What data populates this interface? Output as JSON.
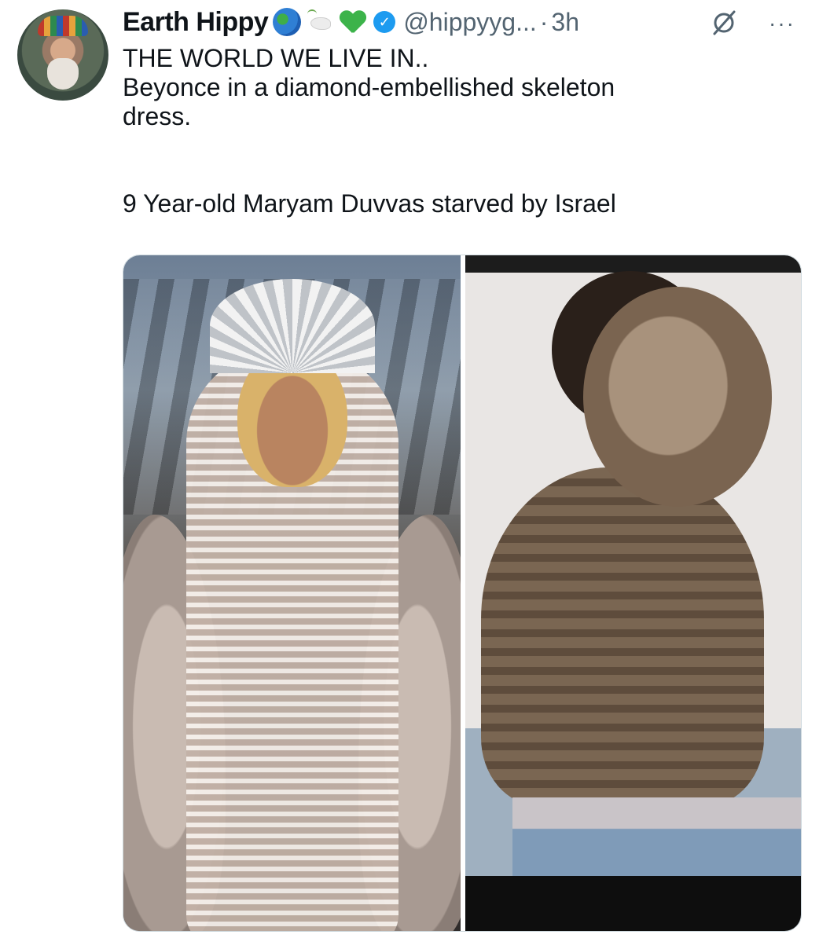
{
  "post": {
    "display_name": "Earth Hippy",
    "name_emojis": [
      "globe-icon",
      "dove-icon",
      "green-heart-icon"
    ],
    "verified_mark": "✓",
    "handle": "@hippyyg...",
    "separator": "·",
    "timestamp": "3h",
    "more_label": "···",
    "text_lines": [
      "THE WORLD WE LIVE IN..",
      "Beyonce in a diamond-embellished skeleton",
      "dress.",
      "9 Year-old Maryam Duvvas starved by Israel"
    ]
  },
  "colors": {
    "text": "#0f1419",
    "secondary": "#536471",
    "verified": "#1d9bf0",
    "border": "#cfd9de"
  }
}
